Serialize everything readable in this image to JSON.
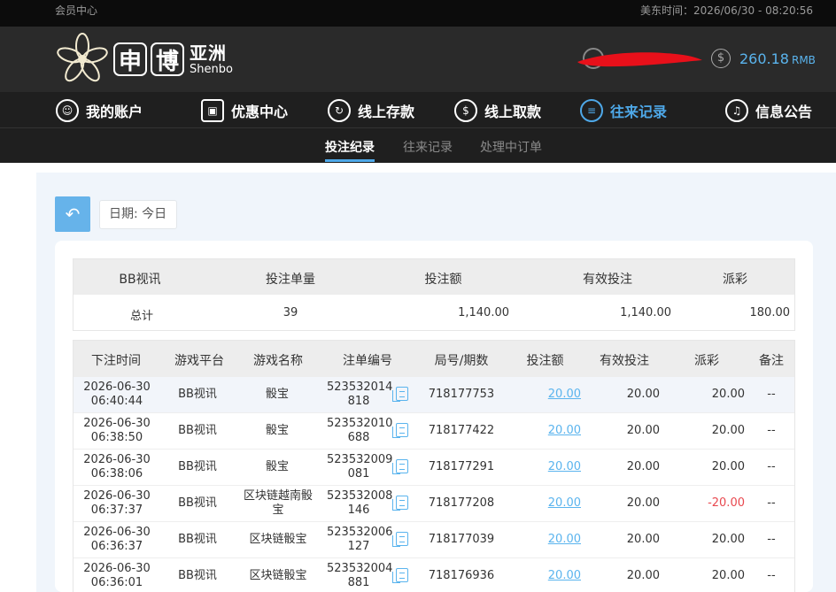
{
  "topbar": {
    "member_center": "会员中心",
    "time_label": "美东时间：2026/06/30 - 08:20:56"
  },
  "header": {
    "logo_char1": "申",
    "logo_char2": "博",
    "logo_cn": "亚洲",
    "logo_en": "Shenbo",
    "balance": "260.18",
    "currency": "RMB",
    "redaction_color": "#e8101a"
  },
  "nav": {
    "items": [
      {
        "label": "我的账户",
        "icon": "user-icon"
      },
      {
        "label": "优惠中心",
        "icon": "gift-icon"
      },
      {
        "label": "线上存款",
        "icon": "deposit-icon"
      },
      {
        "label": "线上取款",
        "icon": "withdraw-icon"
      },
      {
        "label": "往来记录",
        "icon": "records-icon"
      },
      {
        "label": "信息公告",
        "icon": "bell-icon"
      }
    ],
    "active_color": "#4ea8e8"
  },
  "subnav": {
    "items": [
      "投注纪录",
      "往来记录",
      "处理中订单"
    ]
  },
  "filter": {
    "date_label": "日期: 今日"
  },
  "summary": {
    "headers": [
      "BB视讯",
      "投注单量",
      "投注额",
      "有效投注",
      "派彩"
    ],
    "values": [
      "总计",
      "39",
      "1,140.00",
      "1,140.00",
      "180.00"
    ]
  },
  "table": {
    "headers": [
      "下注时间",
      "游戏平台",
      "游戏名称",
      "注单编号",
      "局号/期数",
      "投注额",
      "有效投注",
      "派彩",
      "备注"
    ],
    "rows": [
      {
        "date": "2026-06-30",
        "time": "06:40:44",
        "platform": "BB视讯",
        "game": "骰宝",
        "game2": "",
        "order1": "523532014",
        "order2": "818",
        "round": "718177753",
        "bet": "20.00",
        "valid": "20.00",
        "payout": "20.00",
        "note": "--"
      },
      {
        "date": "2026-06-30",
        "time": "06:38:50",
        "platform": "BB视讯",
        "game": "骰宝",
        "game2": "",
        "order1": "523532010",
        "order2": "688",
        "round": "718177422",
        "bet": "20.00",
        "valid": "20.00",
        "payout": "20.00",
        "note": "--"
      },
      {
        "date": "2026-06-30",
        "time": "06:38:06",
        "platform": "BB视讯",
        "game": "骰宝",
        "game2": "",
        "order1": "523532009",
        "order2": "081",
        "round": "718177291",
        "bet": "20.00",
        "valid": "20.00",
        "payout": "20.00",
        "note": "--"
      },
      {
        "date": "2026-06-30",
        "time": "06:37:37",
        "platform": "BB视讯",
        "game": "区块链越南骰",
        "game2": "宝",
        "order1": "523532008",
        "order2": "146",
        "round": "718177208",
        "bet": "20.00",
        "valid": "20.00",
        "payout": "-20.00",
        "note": "--"
      },
      {
        "date": "2026-06-30",
        "time": "06:36:37",
        "platform": "BB视讯",
        "game": "区块链骰宝",
        "game2": "",
        "order1": "523532006",
        "order2": "127",
        "round": "718177039",
        "bet": "20.00",
        "valid": "20.00",
        "payout": "20.00",
        "note": "--"
      },
      {
        "date": "2026-06-30",
        "time": "06:36:01",
        "platform": "BB视讯",
        "game": "区块链骰宝",
        "game2": "",
        "order1": "523532004",
        "order2": "881",
        "round": "718176936",
        "bet": "20.00",
        "valid": "20.00",
        "payout": "20.00",
        "note": "--"
      }
    ]
  }
}
